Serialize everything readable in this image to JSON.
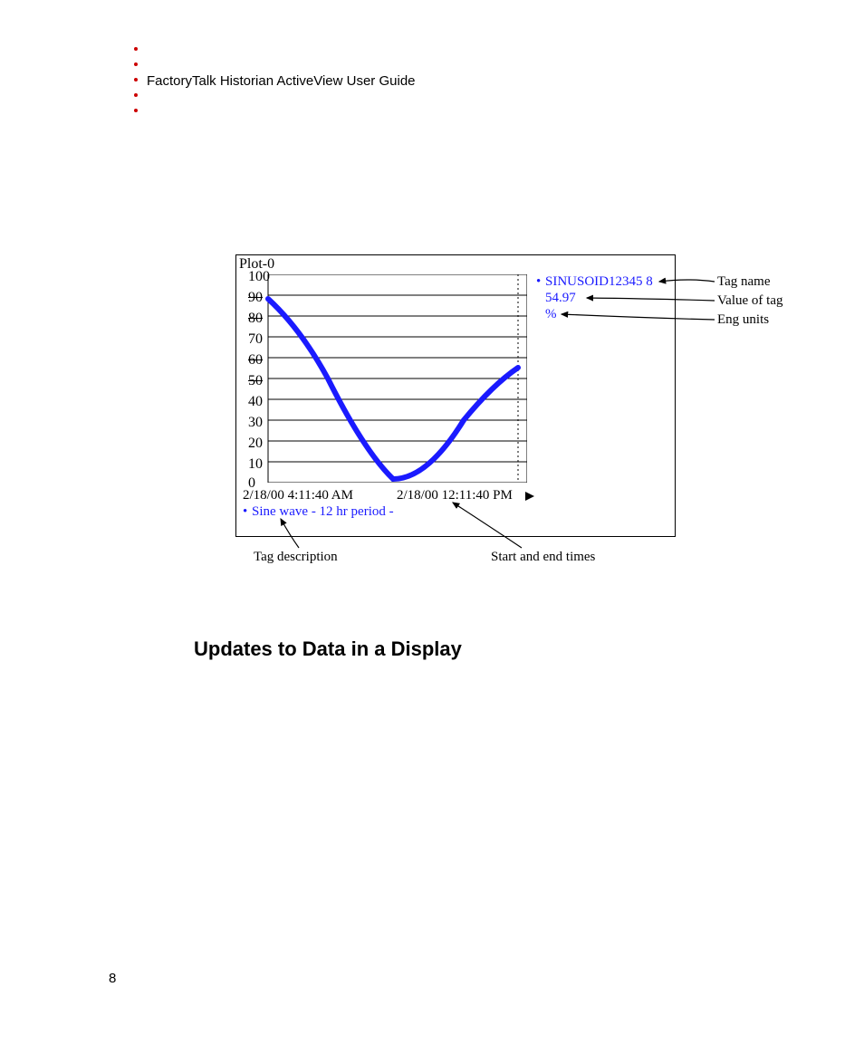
{
  "header": {
    "doc_title": "FactoryTalk Historian ActiveView User Guide"
  },
  "figure": {
    "plot_name": "Plot-0",
    "y_ticks": [
      "100",
      "90",
      "80",
      "70",
      "60",
      "50",
      "40",
      "30",
      "20",
      "10",
      "0"
    ],
    "x_start": "2/18/00 4:11:40 AM",
    "x_end": "2/18/00 12:11:40 PM",
    "tag_name": "SINUSOID12345 8",
    "tag_value": "54.97",
    "tag_units": "%",
    "tag_description": "Sine wave - 12 hr period -",
    "callouts": {
      "tag_name": "Tag name",
      "value": "Value of tag",
      "units": "Eng units",
      "desc": "Tag description",
      "times": "Start and end times"
    }
  },
  "section_heading": "Updates to Data in a Display",
  "page_number": "8",
  "chart_data": {
    "type": "line",
    "title": "Plot-0",
    "xlabel": "",
    "ylabel": "",
    "ylim": [
      0,
      100
    ],
    "categories": [
      "2/18/00 4:11:40 AM",
      "",
      "",
      "",
      "",
      "",
      "",
      "",
      "2/18/00 12:11:40 PM"
    ],
    "series": [
      {
        "name": "SINUSOID12345 8",
        "description": "Sine wave - 12 hr period -",
        "units": "%",
        "current_value": 54.97,
        "values": [
          88,
          60,
          30,
          8,
          0,
          8,
          30,
          50,
          55
        ]
      }
    ]
  }
}
